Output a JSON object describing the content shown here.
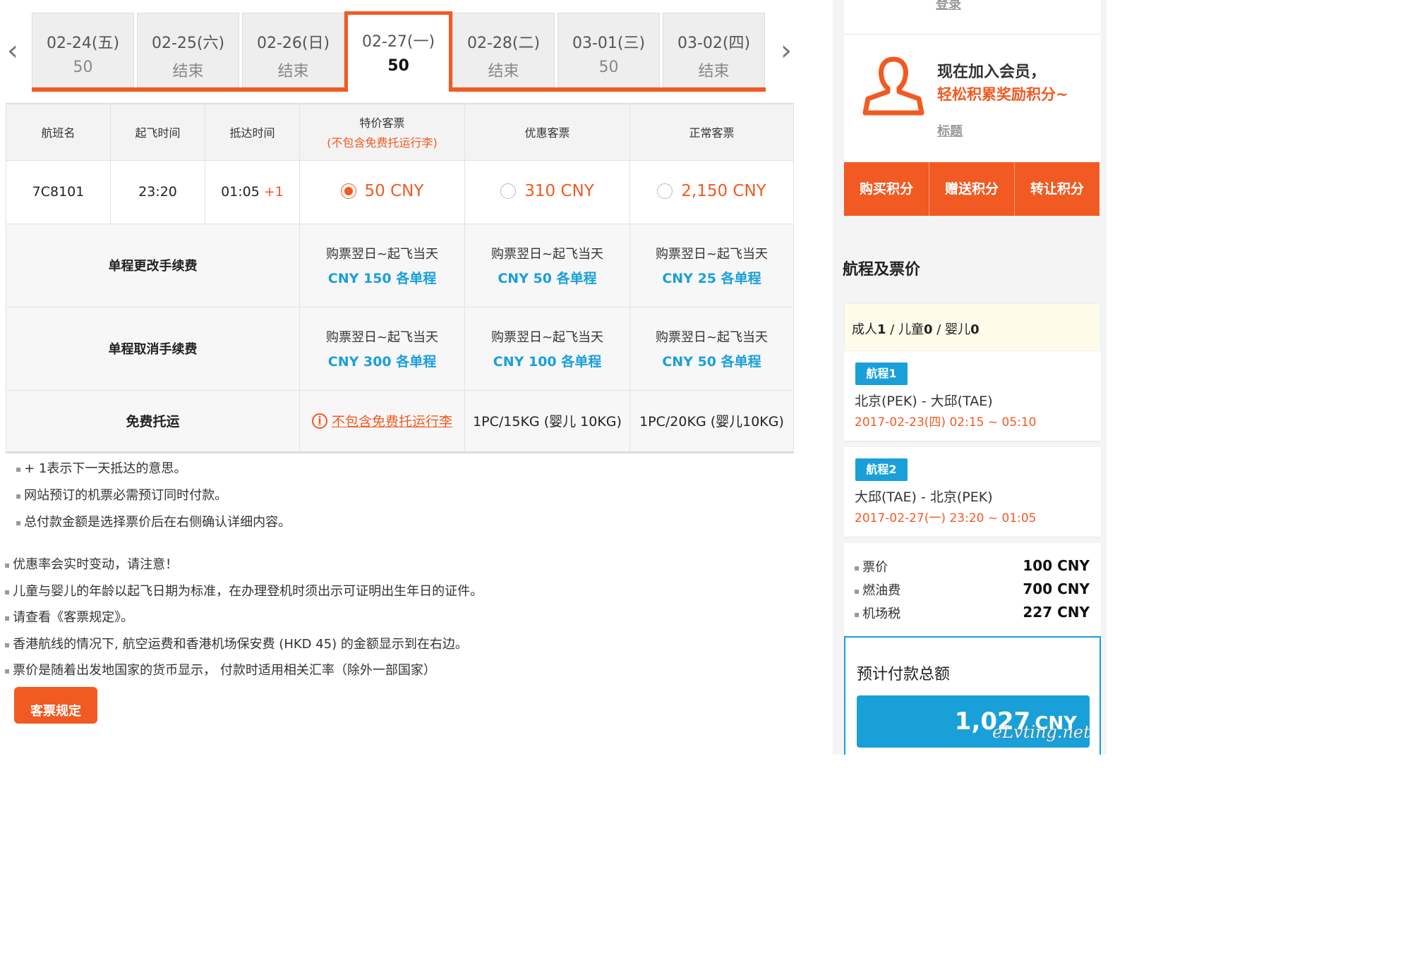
{
  "date_tabs": [
    {
      "date": "02-24(五)",
      "price": "50",
      "active": false
    },
    {
      "date": "02-25(六)",
      "price": "结束",
      "active": false
    },
    {
      "date": "02-26(日)",
      "price": "结束",
      "active": false
    },
    {
      "date": "02-27(一)",
      "price": "50",
      "active": true
    },
    {
      "date": "02-28(二)",
      "price": "结束",
      "active": false
    },
    {
      "date": "03-01(三)",
      "price": "50",
      "active": false
    },
    {
      "date": "03-02(四)",
      "price": "结束",
      "active": false
    }
  ],
  "nav": {
    "prev": "‹",
    "next": "›"
  },
  "table": {
    "headers": {
      "flight": "航班名",
      "depart": "起飞时间",
      "arrive": "抵达时间",
      "special": "特价客票",
      "special_note": "(不包含免费托运行李)",
      "discount": "优惠客票",
      "normal": "正常客票"
    },
    "flight": {
      "number": "7C8101",
      "depart_time": "23:20",
      "arrive_time": "01:05",
      "next_day": "+1",
      "fares": [
        "50 CNY",
        "310 CNY",
        "2,150 CNY"
      ],
      "selected_index": 0
    },
    "change_fee": {
      "label": "单程更改手续费",
      "cells": [
        {
          "when": "购票翌日~起飞当天",
          "amount": "CNY 150 各单程"
        },
        {
          "when": "购票翌日~起飞当天",
          "amount": "CNY 50 各单程"
        },
        {
          "when": "购票翌日~起飞当天",
          "amount": "CNY 25 各单程"
        }
      ]
    },
    "cancel_fee": {
      "label": "单程取消手续费",
      "cells": [
        {
          "when": "购票翌日~起飞当天",
          "amount": "CNY 300 各单程"
        },
        {
          "when": "购票翌日~起飞当天",
          "amount": "CNY 100 各单程"
        },
        {
          "when": "购票翌日~起飞当天",
          "amount": "CNY 50 各单程"
        }
      ]
    },
    "baggage": {
      "label": "免费托运",
      "special_link": "不包含免费托运行李",
      "discount": "1PC/15KG (婴儿 10KG)",
      "normal": "1PC/20KG (婴儿10KG)"
    }
  },
  "notes_table": [
    "+ 1表示下一天抵达的意思。",
    "网站预订的机票必需预订同时付款。",
    "总付款金额是选择票价后在右侧确认详细内容。"
  ],
  "notes_general": [
    "优惠率会实时变动，请注意！",
    "儿童与婴儿的年龄以起飞日期为标准，在办理登机时须出示可证明出生年日的证件。",
    "请查看《客票规定》。",
    "香港航线的情况下, 航空运费和香港机场保安费 (HKD 45) 的金额显示到在右边。",
    "票价是随着出发地国家的货币显示， 付款时适用相关汇率（除外一部国家）"
  ],
  "rules_button": "客票规定",
  "sidebar": {
    "login": "登录",
    "join_line1": "现在加入会员，",
    "join_line2": "轻松积累奖励积分~",
    "title_link": "标题",
    "points_buttons": [
      "购买积分",
      "赠送积分",
      "转让积分"
    ],
    "section_title": "航程及票价",
    "pax": {
      "adult_label": "成人",
      "adult": "1",
      "child_label": "儿童",
      "child": "0",
      "infant_label": "婴儿",
      "infant": "0"
    },
    "legs": [
      {
        "badge": "航程1",
        "route": "北京(PEK) - 大邱(TAE)",
        "time": "2017-02-23(四) 02:15 ~ 05:10"
      },
      {
        "badge": "航程2",
        "route": "大邱(TAE) - 北京(PEK)",
        "time": "2017-02-27(一) 23:20 ~ 01:05"
      }
    ],
    "prices": [
      {
        "label": "票价",
        "value": "100 CNY"
      },
      {
        "label": "燃油费",
        "value": "700 CNY"
      },
      {
        "label": "机场税",
        "value": "227 CNY"
      }
    ],
    "total_label": "预计付款总额",
    "total_amount": "1,027",
    "total_currency": "CNY"
  },
  "watermark": "eLvting.net",
  "colors": {
    "accent": "#f15a22",
    "blue": "#1aa0d8"
  },
  "icons": [
    "chevron-left-icon",
    "chevron-right-icon",
    "radio-icon",
    "info-icon",
    "person-icon"
  ]
}
